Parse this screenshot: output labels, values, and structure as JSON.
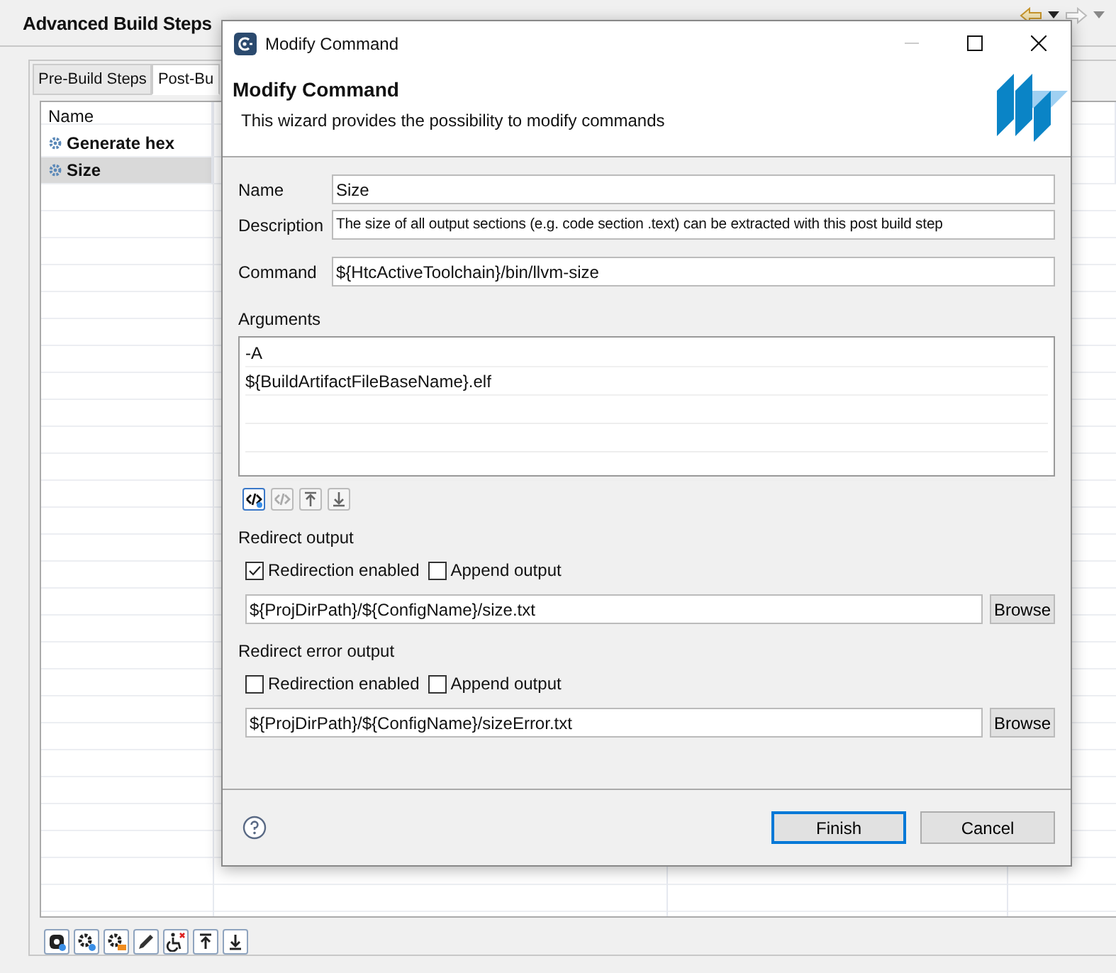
{
  "main": {
    "title": "Advanced Build Steps",
    "tabs": [
      {
        "label": "Pre-Build Steps",
        "selected": false
      },
      {
        "label": "Post-Bu",
        "selected": true
      }
    ],
    "table": {
      "columns": [
        "Name"
      ],
      "rows": [
        {
          "name": "Generate hex",
          "selected": false
        },
        {
          "name": "Size",
          "selected": true
        }
      ]
    }
  },
  "dialog": {
    "title": "Modify Command",
    "heading": "Modify Command",
    "subtitle": "This wizard provides the possibility to modify commands",
    "fields": [
      {
        "label": "Name",
        "value": "Size"
      },
      {
        "label": "Description",
        "value": "The size of all output sections (e.g. code section .text) can be extracted with this post build step"
      },
      {
        "label": "Command",
        "value": "${HtcActiveToolchain}/bin/llvm-size"
      }
    ],
    "arguments": {
      "label": "Arguments",
      "items": [
        "-A",
        "${BuildArtifactFileBaseName}.elf"
      ]
    },
    "redirects": [
      {
        "title": "Redirect output",
        "options": [
          {
            "label": "Redirection enabled",
            "checked": true
          },
          {
            "label": "Append output",
            "checked": false
          }
        ],
        "path": "${ProjDirPath}/${ConfigName}/size.txt",
        "button": "Browse"
      },
      {
        "title": "Redirect error output",
        "options": [
          {
            "label": "Redirection enabled",
            "checked": false
          },
          {
            "label": "Append output",
            "checked": false
          }
        ],
        "path": "${ProjDirPath}/${ConfigName}/sizeError.txt",
        "button": "Browse"
      }
    ],
    "buttons": [
      {
        "label": "Finish",
        "default": true
      },
      {
        "label": "Cancel",
        "default": false
      }
    ]
  }
}
